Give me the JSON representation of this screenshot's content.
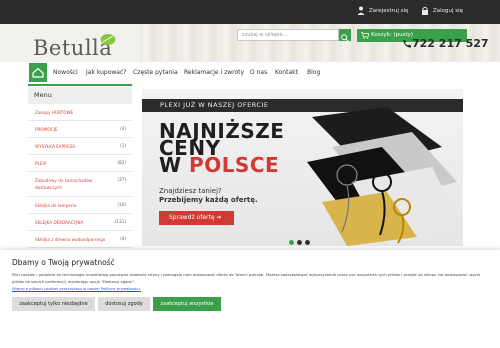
{
  "topbar": {
    "register_label": "Zarejestruj się",
    "login_label": "Zaloguj się"
  },
  "header": {
    "logo_text": "Betulla",
    "search_placeholder": "szukaj w sklepie...",
    "cart_label": "Koszyk: (pusty)",
    "phone": "722 217 527"
  },
  "nav": {
    "items": [
      "Nowości",
      "Jak kupować?",
      "Częste pytania",
      "Reklamacje i zwroty",
      "O nas",
      "Kontakt",
      "Blog"
    ]
  },
  "menu": {
    "title": "Menu",
    "items": [
      {
        "label": "Zakupy HURTOWE",
        "count": ""
      },
      {
        "label": "PROMOCJE",
        "count": "(4)"
      },
      {
        "label": "WYSYŁKA EXPRESS",
        "count": "(1)"
      },
      {
        "label": "PLEXI",
        "count": "(82)"
      },
      {
        "label": "Zabudowy do samochodów dostawczych",
        "count": "(37)"
      },
      {
        "label": "Sklejka do lamperia",
        "count": "(10)"
      },
      {
        "label": "SKLEJKA DEKORACYJNA",
        "count": "(131)"
      },
      {
        "label": "Sklejka z drewna wodoodpornego",
        "count": "(4)"
      }
    ]
  },
  "banner": {
    "strip_text": "PLEXI JUŻ W NASZEJ OFERCIE",
    "title_line1": "NAJNIŻSZE",
    "title_line2": "CENY",
    "title_line3_prefix": "W",
    "title_line3_red": "POLSCE",
    "sub_line1": "Znajdziesz taniej?",
    "sub_line2": "Przebijemy każdą ofertę.",
    "button_label": "Sprawdź ofertę  ➔",
    "active_slide": 1,
    "slide_count": 3
  },
  "cookie": {
    "title": "Dbamy o Twoją prywatność",
    "text": "Pliki cookies i podobne im technologie umożliwiają poprawne działanie strony i pomagają nam dostosować ofertę do Twoich potrzeb. Możesz zaakceptować wykorzystanie przez nas wszystkich tych plików i przejść do sklepu lub dostosować użycie plików do swoich preferencji, wybierając opcję \"Dostosuj zgody\".",
    "link_text": "Więcej o plikach cookies przeczytasz w naszej Polityce prywatności.",
    "btn_necessary": "zaakceptuj tylko niezbędne",
    "btn_customize": "dostosuj zgody",
    "btn_accept_all": "zaakceptuj wszystkie"
  },
  "colors": {
    "brand_green": "#3aa14a",
    "accent_red": "#d13a33",
    "topbar_dark": "#2b2b2b"
  }
}
